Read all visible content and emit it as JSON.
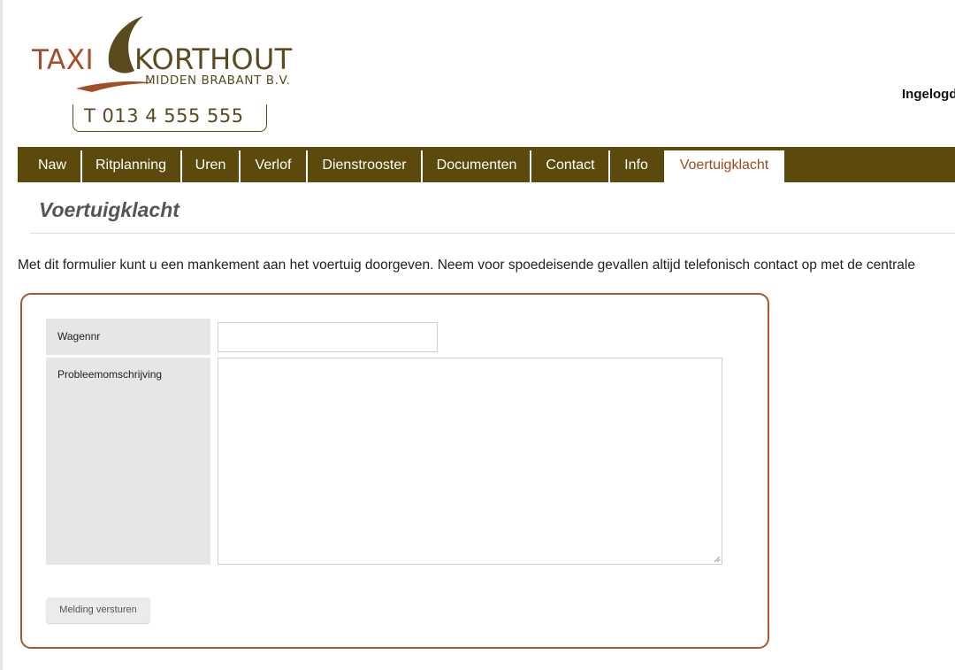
{
  "logo": {
    "taxi": "TAXI",
    "name": "KORTHOUT",
    "subtitle": "MIDDEN BRABANT B.V.",
    "phone": "T 013 4 555 555"
  },
  "header": {
    "login_status": "Ingelogd"
  },
  "nav": {
    "items": [
      {
        "label": "Naw"
      },
      {
        "label": "Ritplanning"
      },
      {
        "label": "Uren"
      },
      {
        "label": "Verlof"
      },
      {
        "label": "Dienstrooster"
      },
      {
        "label": "Documenten"
      },
      {
        "label": "Contact"
      },
      {
        "label": "Info"
      },
      {
        "label": "Voertuigklacht"
      }
    ],
    "active": "Voertuigklacht"
  },
  "page": {
    "title": "Voertuigklacht",
    "intro": "Met dit formulier kunt u een mankement aan het voertuig doorgeven. Neem voor spoedeisende gevallen altijd telefonisch contact op met de centrale"
  },
  "form": {
    "wagennr_label": "Wagennr",
    "wagennr_value": "",
    "probleem_label": "Probleemomschrijving",
    "probleem_value": "",
    "submit_label": "Melding versturen"
  },
  "colors": {
    "nav_bg": "#5b4a0c",
    "accent": "#a7582d",
    "active_tab_text": "#9b4c1f"
  }
}
